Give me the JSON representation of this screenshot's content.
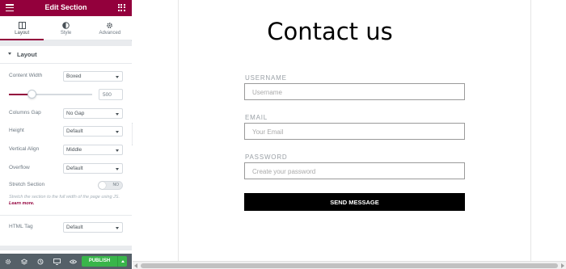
{
  "panel": {
    "title": "Edit Section",
    "tabs": [
      {
        "label": "Layout",
        "icon": "layout-icon",
        "active": true
      },
      {
        "label": "Style",
        "icon": "half-circle-icon",
        "active": false
      },
      {
        "label": "Advanced",
        "icon": "gear-icon",
        "active": false
      }
    ],
    "section_title": "Layout",
    "controls": {
      "content_width": {
        "label": "Content Width",
        "value": "Boxed"
      },
      "width_slider": {
        "value": "500"
      },
      "columns_gap": {
        "label": "Columns Gap",
        "value": "No Gap"
      },
      "height": {
        "label": "Height",
        "value": "Default"
      },
      "vertical_align": {
        "label": "Vertical Align",
        "value": "Middle"
      },
      "overflow": {
        "label": "Overflow",
        "value": "Default"
      },
      "stretch_section": {
        "label": "Stretch Section",
        "toggle_text": "NO",
        "enabled": false
      },
      "stretch_desc": "Stretch the section to the full width of the page using JS.",
      "learn_more": "Learn more.",
      "html_tag": {
        "label": "HTML Tag",
        "value": "Default"
      }
    }
  },
  "footer": {
    "icons": [
      "settings-icon",
      "layers-icon",
      "history-icon",
      "responsive-icon",
      "preview-eye-icon"
    ],
    "publish_label": "PUBLISH"
  },
  "preview": {
    "title": "Contact us",
    "fields": [
      {
        "label": "USERNAME",
        "placeholder": "Username"
      },
      {
        "label": "EMAIL",
        "placeholder": "Your Email"
      },
      {
        "label": "PASSWORD",
        "placeholder": "Create your password"
      }
    ],
    "submit_label": "SEND MESSAGE"
  },
  "colors": {
    "brand": "#93003c",
    "publish": "#39b54a",
    "footer": "#556068"
  }
}
